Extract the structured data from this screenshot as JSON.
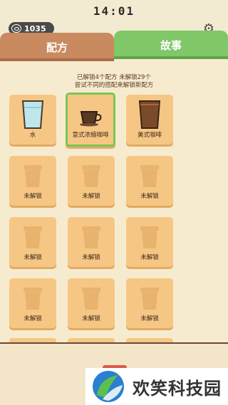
{
  "status": {
    "time": "14:01",
    "coins": "1035"
  },
  "tabs": {
    "recipe": "配方",
    "story": "故事"
  },
  "info": {
    "line1": "已解锁4个配方 未解锁29个",
    "line2": "尝试不同的搭配来解锁新配方"
  },
  "recipes": [
    {
      "label": "水",
      "state": "unlocked",
      "icon": "water-glass-icon"
    },
    {
      "label": "意式浓缩咖啡",
      "state": "selected",
      "icon": "espresso-cup-icon"
    },
    {
      "label": "美式咖啡",
      "state": "unlocked",
      "icon": "americano-glass-icon"
    },
    {
      "label": "未解锁",
      "state": "locked",
      "icon": "locked-cup-icon"
    },
    {
      "label": "未解锁",
      "state": "locked",
      "icon": "locked-cup-icon"
    },
    {
      "label": "未解锁",
      "state": "locked",
      "icon": "locked-cup-icon"
    },
    {
      "label": "未解锁",
      "state": "locked",
      "icon": "locked-cup-icon"
    },
    {
      "label": "未解锁",
      "state": "locked",
      "icon": "locked-cup-icon"
    },
    {
      "label": "未解锁",
      "state": "locked",
      "icon": "locked-cup-icon"
    },
    {
      "label": "未解锁",
      "state": "locked",
      "icon": "locked-cup-icon"
    },
    {
      "label": "未解锁",
      "state": "locked",
      "icon": "locked-cup-icon"
    },
    {
      "label": "未解锁",
      "state": "locked",
      "icon": "locked-cup-icon"
    }
  ],
  "watermark": {
    "text": "欢笑科技园"
  },
  "colors": {
    "recipe_tab": "#c98a5f",
    "story_tab": "#7fc767",
    "card": "#f6c784",
    "selected_border": "#78c75a"
  }
}
